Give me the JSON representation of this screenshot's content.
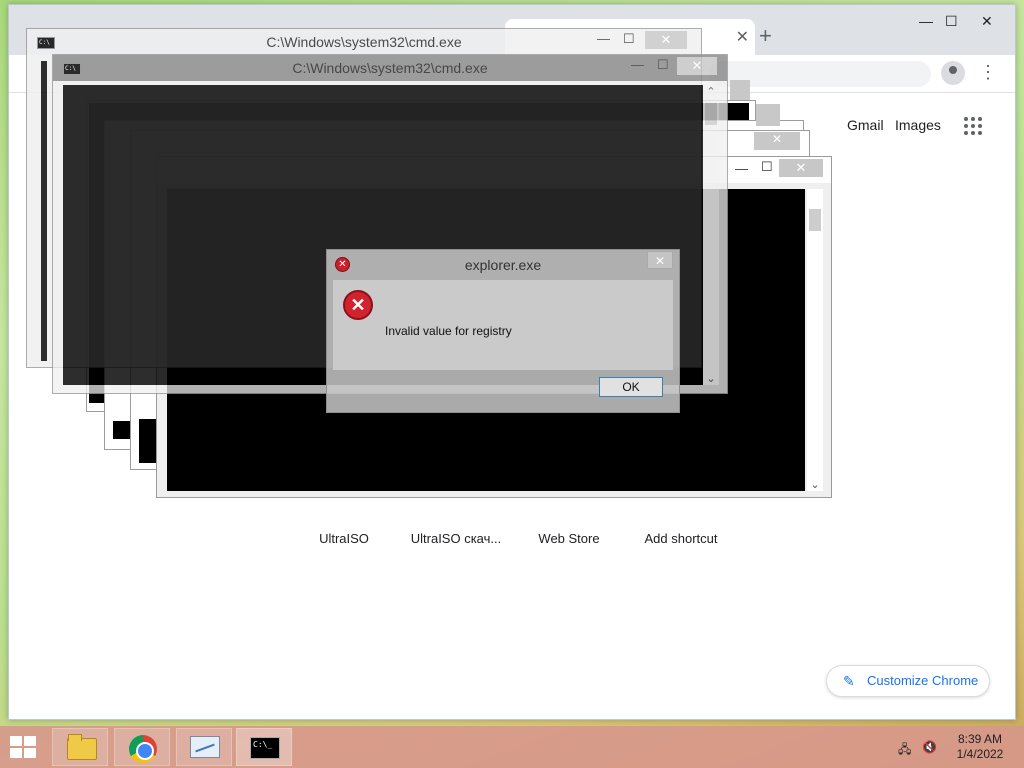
{
  "chrome": {
    "gmail": "Gmail",
    "images": "Images",
    "shortcuts": [
      "UltraISO",
      "UltraISO скач...",
      "Web Store",
      "Add shortcut"
    ],
    "customize_label": "Customize Chrome",
    "tab_close_icon": "close-icon",
    "new_tab_icon": "plus-icon"
  },
  "cmd_windows": {
    "title": "C:\\Windows\\system32\\cmd.exe"
  },
  "dialog": {
    "title": "explorer.exe",
    "message": "Invalid value for registry",
    "ok_label": "OK",
    "icon": "error-icon"
  },
  "taskbar": {
    "time": "8:39 AM",
    "date": "1/4/2022",
    "apps": [
      "file-explorer-icon",
      "chrome-icon",
      "task-manager-icon",
      "cmd-icon"
    ]
  },
  "colors": {
    "dialog_error": "#d0232d",
    "chrome_link": "#1a73e8",
    "taskbar": "#d7968c"
  }
}
